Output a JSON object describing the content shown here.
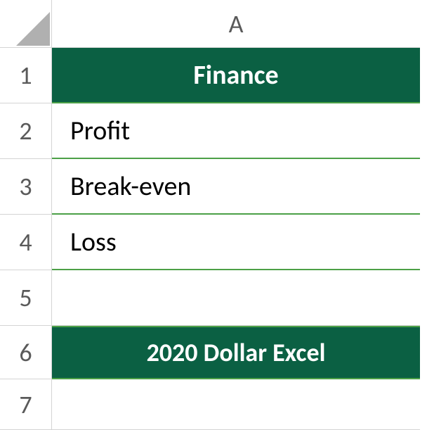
{
  "columns": {
    "A": "A"
  },
  "rows": {
    "r1": "1",
    "r2": "2",
    "r3": "3",
    "r4": "4",
    "r5": "5",
    "r6": "6",
    "r7": "7"
  },
  "cells": {
    "A1": "Finance",
    "A2": "Profit",
    "A3": "Break-even",
    "A4": "Loss",
    "A5": "",
    "A6": "2020 Dollar Excel",
    "A7": ""
  },
  "colors": {
    "headerBg": "#0b6043",
    "headerText": "#ffffff",
    "borderGreen": "#4ca047",
    "gridBorder": "#d4d4d4"
  }
}
